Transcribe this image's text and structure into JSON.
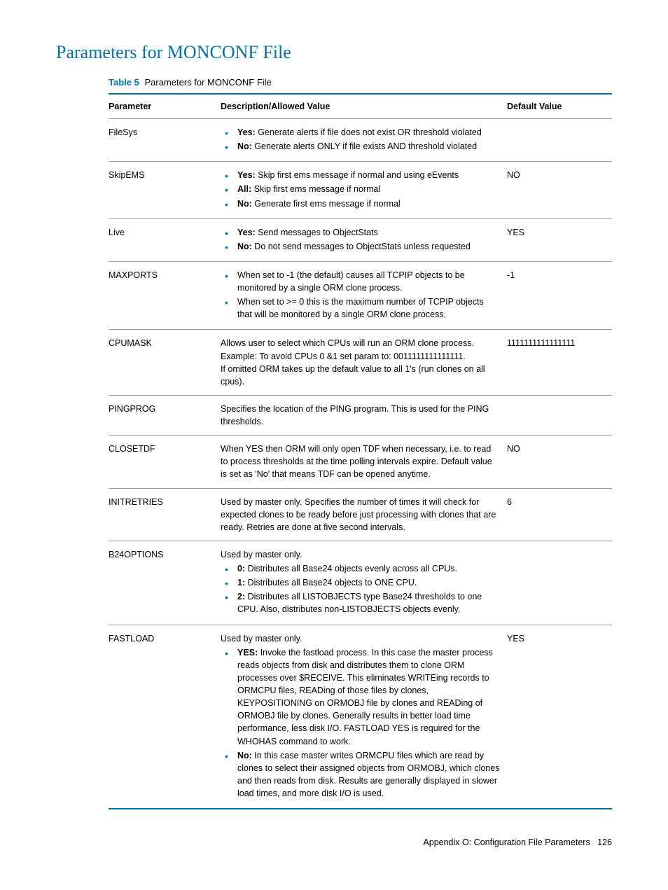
{
  "pageTitle": "Parameters for MONCONF File",
  "tableCaption": {
    "label": "Table 5",
    "text": "Parameters for MONCONF File"
  },
  "headers": {
    "param": "Parameter",
    "desc": "Description/Allowed Value",
    "default": "Default Value"
  },
  "rows": {
    "filesys": {
      "name": "FileSys",
      "items": [
        {
          "b": "Yes:",
          "t": " Generate alerts if file does not exist OR threshold violated"
        },
        {
          "b": "No:",
          "t": " Generate alerts ONLY if file exists AND threshold violated"
        }
      ],
      "default": ""
    },
    "skipems": {
      "name": "SkipEMS",
      "items": [
        {
          "b": "Yes:",
          "t": " Skip first ems message if normal and using eEvents"
        },
        {
          "b": "All:",
          "t": " Skip first ems message if normal"
        },
        {
          "b": "No:",
          "t": " Generate first ems message if normal"
        }
      ],
      "default": "NO"
    },
    "live": {
      "name": "Live",
      "items": [
        {
          "b": "Yes:",
          "t": " Send messages to ObjectStats"
        },
        {
          "b": "No:",
          "t": " Do not send messages to ObjectStats unless requested"
        }
      ],
      "default": "YES"
    },
    "maxports": {
      "name": "MAXPORTS",
      "items": [
        {
          "b": "",
          "t": "When set to -1 (the default) causes all TCPIP objects to be monitored by a single ORM clone process."
        },
        {
          "b": "",
          "t": "When set to >= 0 this is the maximum number of TCPIP objects that will be monitored by a single ORM clone process."
        }
      ],
      "default": "-1"
    },
    "cpumask": {
      "name": "CPUMASK",
      "desc": "Allows user to select which CPUs will run an ORM clone process. Example: To avoid CPUs 0 &1 set param to: 0011111111111111.\nIf omitted ORM takes up the default value to all 1's (run clones on all cpus).",
      "default": "1111111111111111"
    },
    "pingprog": {
      "name": "PINGPROG",
      "desc": "Specifies the location of the PING program. This is used for the PING thresholds.",
      "default": ""
    },
    "closetdf": {
      "name": "CLOSETDF",
      "desc": "When YES then ORM will only open TDF when necessary, i.e. to read to process thresholds at the time polling intervals expire. Default value is set as 'No' that means TDF can be opened anytime.",
      "default": "NO"
    },
    "initretries": {
      "name": "INITRETRIES",
      "desc": "Used by master only. Specifies the number of times it will check for expected clones to be ready before just processing with clones that are ready. Retries are done at five second intervals.",
      "default": "6"
    },
    "b24options": {
      "name": "B24OPTIONS",
      "intro": "Used by master only.",
      "items": [
        {
          "b": "0:",
          "t": " Distributes all Base24 objects evenly across all CPUs."
        },
        {
          "b": "1:",
          "t": " Distributes all Base24 objects to ONE CPU."
        },
        {
          "b": "2:",
          "t": " Distributes all LISTOBJECTS type Base24 thresholds to one CPU. Also, distributes non-LISTOBJECTS objects evenly."
        }
      ],
      "default": ""
    },
    "fastload": {
      "name": "FASTLOAD",
      "intro": "Used by master only.",
      "items": [
        {
          "b": "YES:",
          "t": " Invoke the fastload process. In this case the master process reads objects from disk and distributes them to clone ORM processes over $RECEIVE. This eliminates WRITEing records to ORMCPU files, READing of those files by clones, KEYPOSITIONING on ORMOBJ file by clones and READing of ORMOBJ file by clones. Generally results in better load time performance, less disk I/O. FASTLOAD YES is required for the WHOHAS command to work."
        },
        {
          "b": "No:",
          "t": " In this case master writes ORMCPU files which are read by clones to select their assigned objects from ORMOBJ, which clones and then reads from disk. Results are generally displayed in slower load times, and more disk I/O is used."
        }
      ],
      "default": "YES"
    }
  },
  "footer": {
    "text": "Appendix O: Configuration File Parameters",
    "page": "126"
  }
}
